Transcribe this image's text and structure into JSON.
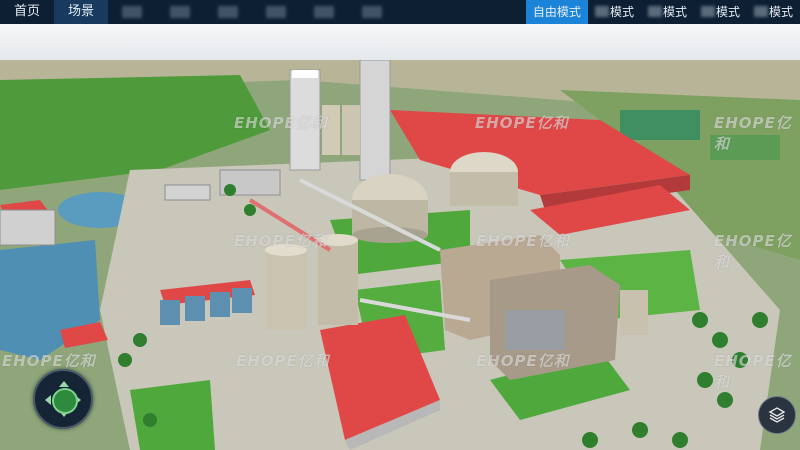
{
  "nav": {
    "home": "首页",
    "scene": "场景"
  },
  "modes": {
    "free": "自由模式",
    "m2": "模式",
    "m3": "模式",
    "m4": "模式",
    "m5": "模式",
    "m5_char": "式"
  },
  "watermark": {
    "brand": "EHOPE亿和"
  },
  "colors": {
    "topbar": "#0c1f33",
    "active_tab": "#173a5e",
    "active_mode": "#1b84d9",
    "roof_red": "#e04848",
    "grass": "#4fa83c",
    "silo": "#cfc9b8"
  },
  "icons": {
    "compass": "compass-navigation-icon",
    "layers": "layers-icon"
  }
}
